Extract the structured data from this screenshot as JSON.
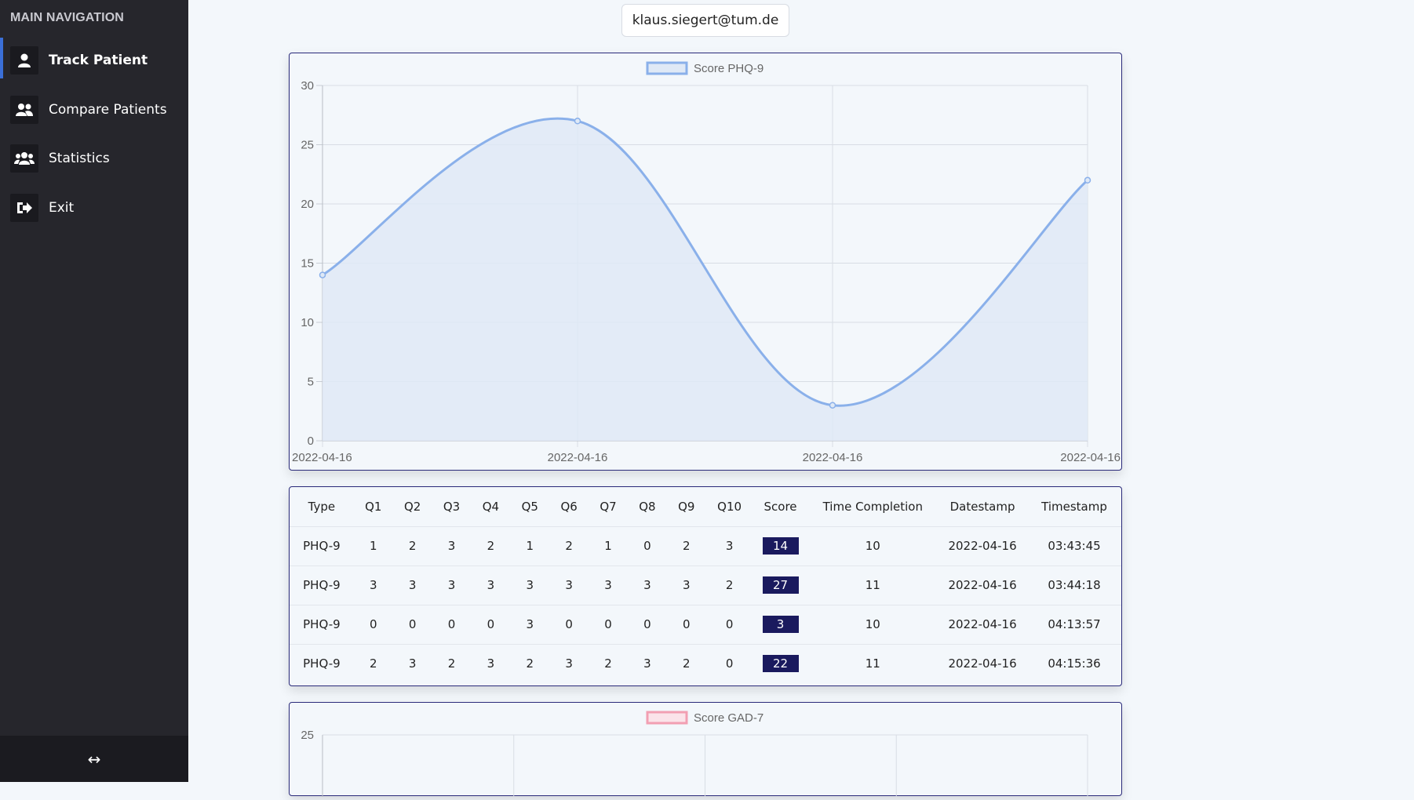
{
  "sidebar": {
    "heading": "MAIN NAVIGATION",
    "items": [
      {
        "label": "Track Patient",
        "icon": "user-icon",
        "active": true
      },
      {
        "label": "Compare Patients",
        "icon": "users-icon",
        "active": false
      },
      {
        "label": "Statistics",
        "icon": "users-group-icon",
        "active": false
      },
      {
        "label": "Exit",
        "icon": "sign-out-icon",
        "active": false
      }
    ],
    "footer_toggle": "↔"
  },
  "header": {
    "email": "klaus.siegert@tum.de"
  },
  "colors": {
    "phq_line": "#8ab0ea",
    "phq_fill": "#dfe9f6",
    "gad_legend": "#f29fb2",
    "badge": "#1a1a5e",
    "card_border": "#2a2a7a"
  },
  "chart_data": [
    {
      "type": "line",
      "legend": "Score PHQ-9",
      "legend_position": "top-center",
      "x": [
        "2022-04-16",
        "2022-04-16",
        "2022-04-16",
        "2022-04-16"
      ],
      "series": [
        {
          "name": "Score PHQ-9",
          "values": [
            14,
            27,
            3,
            22
          ]
        }
      ],
      "ylim": [
        0,
        30
      ],
      "yticks": [
        0,
        5,
        10,
        15,
        20,
        25,
        30
      ],
      "grid": true,
      "filled": true
    },
    {
      "type": "line",
      "legend": "Score GAD-7",
      "legend_position": "top-center",
      "yticks_visible": [
        25
      ],
      "grid": true
    }
  ],
  "table": {
    "headers": [
      "Type",
      "Q1",
      "Q2",
      "Q3",
      "Q4",
      "Q5",
      "Q6",
      "Q7",
      "Q8",
      "Q9",
      "Q10",
      "Score",
      "Time Completion",
      "Datestamp",
      "Timestamp"
    ],
    "rows": [
      [
        "PHQ-9",
        "1",
        "2",
        "3",
        "2",
        "1",
        "2",
        "1",
        "0",
        "2",
        "3",
        "14",
        "10",
        "2022-04-16",
        "03:43:45"
      ],
      [
        "PHQ-9",
        "3",
        "3",
        "3",
        "3",
        "3",
        "3",
        "3",
        "3",
        "3",
        "2",
        "27",
        "11",
        "2022-04-16",
        "03:44:18"
      ],
      [
        "PHQ-9",
        "0",
        "0",
        "0",
        "0",
        "3",
        "0",
        "0",
        "0",
        "0",
        "0",
        "3",
        "10",
        "2022-04-16",
        "04:13:57"
      ],
      [
        "PHQ-9",
        "2",
        "3",
        "2",
        "3",
        "2",
        "3",
        "2",
        "3",
        "2",
        "0",
        "22",
        "11",
        "2022-04-16",
        "04:15:36"
      ]
    ]
  }
}
